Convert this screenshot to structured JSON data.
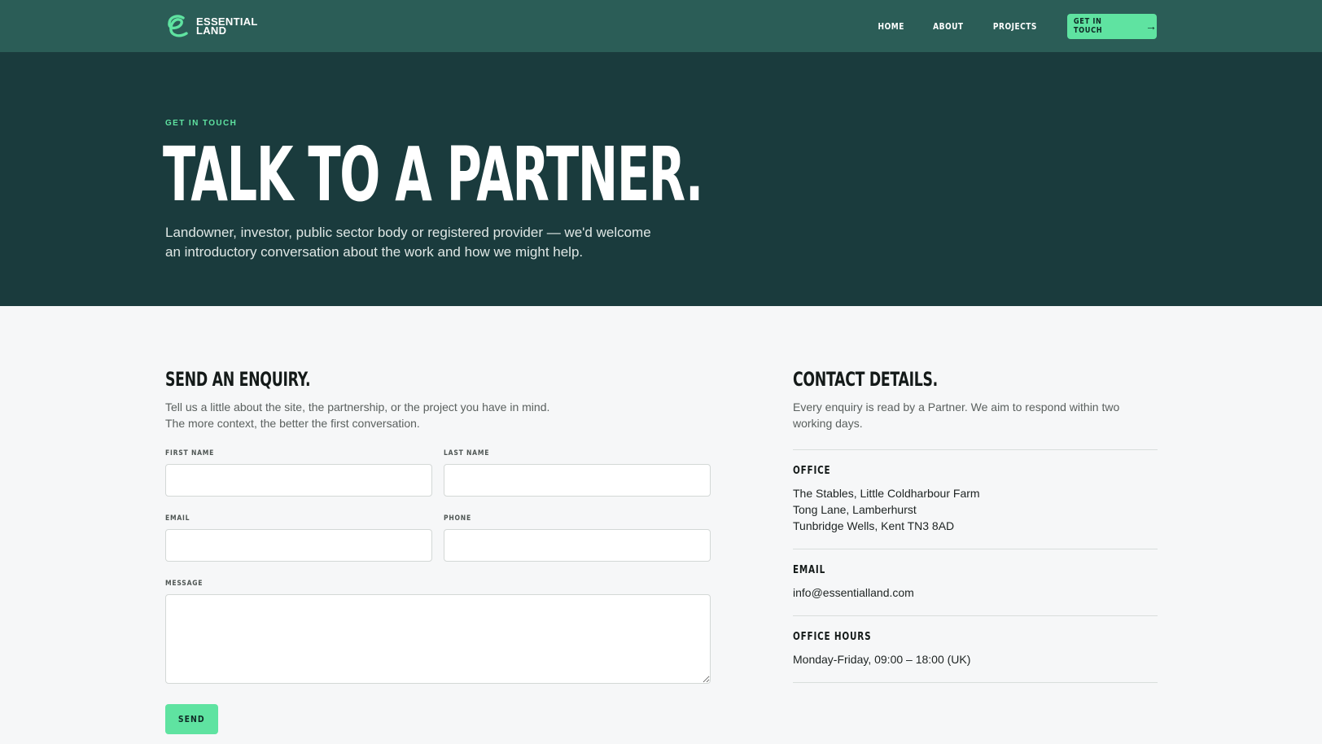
{
  "brand": {
    "name_line1": "ESSENTIAL",
    "name_line2": "LAND",
    "accent_color": "#5fe3a1",
    "nav_bg": "#2b5d57",
    "hero_bg": "#1a3b3d"
  },
  "nav": {
    "items": [
      {
        "label": "HOME"
      },
      {
        "label": "ABOUT"
      },
      {
        "label": "PROJECTS"
      }
    ],
    "cta_label": "GET IN TOUCH",
    "cta_icon": "arrow-right-icon"
  },
  "hero": {
    "eyebrow": "GET IN TOUCH",
    "title": "TALK TO A PARTNER.",
    "subtitle": "Landowner, investor, public sector body or registered provider — we'd welcome an introductory conversation about the work and how we might help."
  },
  "form": {
    "title": "SEND AN ENQUIRY.",
    "intro_line1": "Tell us a little about the site, the partnership, or the project you have in mind.",
    "intro_line2": "The more context, the better the first conversation.",
    "fields": {
      "first_name": {
        "label": "FIRST NAME",
        "value": ""
      },
      "last_name": {
        "label": "LAST NAME",
        "value": ""
      },
      "email": {
        "label": "EMAIL",
        "value": ""
      },
      "phone": {
        "label": "PHONE",
        "value": ""
      },
      "message": {
        "label": "MESSAGE",
        "value": ""
      }
    },
    "submit_label": "SEND"
  },
  "contact": {
    "title": "CONTACT DETAILS.",
    "intro": "Every enquiry is read by a Partner. We aim to respond within two working days.",
    "office": {
      "label": "OFFICE",
      "lines": [
        "The Stables, Little Coldharbour Farm",
        "Tong Lane, Lamberhurst",
        "Tunbridge Wells, Kent TN3 8AD"
      ]
    },
    "email": {
      "label": "EMAIL",
      "value": "info@essentialland.com"
    },
    "hours": {
      "label": "OFFICE HOURS",
      "value": "Monday-Friday, 09:00 – 18:00 (UK)"
    }
  }
}
